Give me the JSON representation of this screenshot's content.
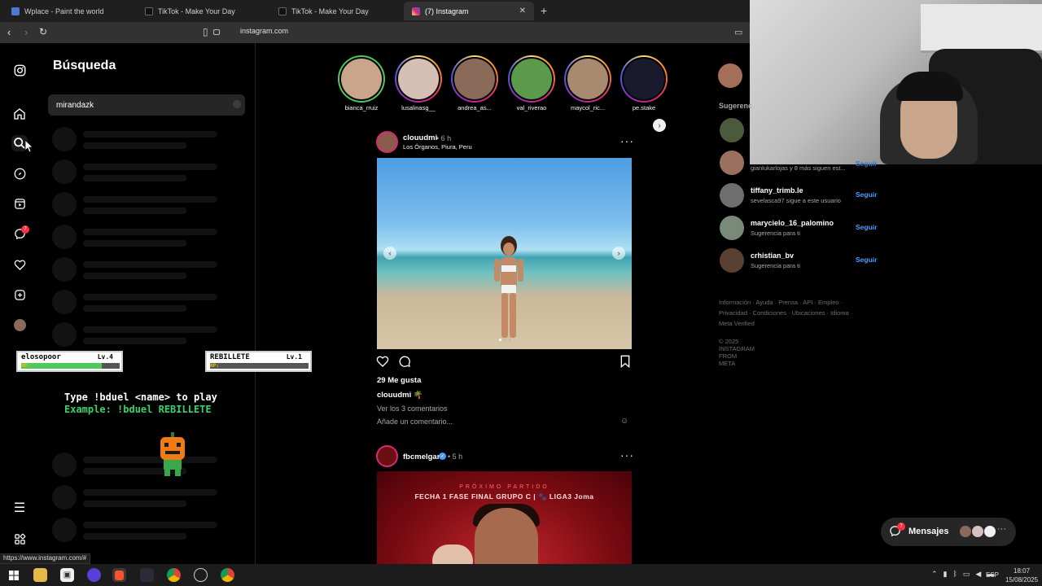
{
  "browser": {
    "tabs": [
      {
        "label": "Wplace - Paint the world",
        "color": "#4a7bd0"
      },
      {
        "label": "TikTok - Make Your Day",
        "color": "#111111"
      },
      {
        "label": "TikTok - Make Your Day",
        "color": "#111111"
      },
      {
        "label": "(7) Instagram",
        "color": "#d62976"
      }
    ],
    "url": "instagram.com",
    "status_url": "https://www.instagram.com/#"
  },
  "search": {
    "title": "Búsqueda",
    "query": "mirandazk"
  },
  "nav": {
    "notifications_badge": "7"
  },
  "overlay": {
    "player1": {
      "name": "elosopoor",
      "level": "Lv.4",
      "hp_label": "HP:",
      "hp_fraction": 0.82
    },
    "player2": {
      "name": "REBILLETE",
      "level": "Lv.1",
      "hp_label": "HP:",
      "hp_fraction": 0.0
    },
    "line1": "Type !bduel <name> to play",
    "line2": "Example: !bduel REBILLETE"
  },
  "stories": [
    {
      "name": "bianca_rruiz",
      "seen": true
    },
    {
      "name": "lusalinasg__",
      "seen": false
    },
    {
      "name": "andrea_as...",
      "seen": false
    },
    {
      "name": "val_riverao",
      "seen": false
    },
    {
      "name": "maycol_ric...",
      "seen": false
    },
    {
      "name": "pe.stake",
      "seen": false
    }
  ],
  "post1": {
    "user": "clouudmi",
    "time": "• 6 h",
    "location": "Los Órganos, Piura, Peru",
    "likes": "29 Me gusta",
    "caption": "clouudmi 🌴",
    "comments": "Ver los 3 comentarios",
    "add_comment": "Añade un comentario..."
  },
  "post2": {
    "user": "fbcmelgar",
    "time": "• 5 h",
    "line1": "PRÓXIMO PARTIDO",
    "line2": "FECHA 1 FASE FINAL GRUPO C | 🐾 LIGA3 Joma"
  },
  "suggestions": {
    "label": "Sugerenc",
    "items": [
      {
        "user": "",
        "sub": ""
      },
      {
        "user": "",
        "sub": "gianlukarlojas y 8 más siguen est..."
      },
      {
        "user": "tiffany_trimb.le",
        "sub": "sevelasca97 sigue a este usuario",
        "follow": "Seguir"
      },
      {
        "user": "marycielo_16_palomino",
        "sub": "Sugerencia para ti",
        "follow": "Seguir"
      },
      {
        "user": "crhistian_bv",
        "sub": "Sugerencia para ti",
        "follow": "Seguir"
      }
    ],
    "hidden_follow": "Seguir",
    "footer": "Información · Ayuda · Prensa · API · Empleo · Privacidad · Condiciones · Ubicaciones · Idioma · Meta Verified",
    "copyright": "© 2025 INSTAGRAM FROM META"
  },
  "messages": {
    "label": "Mensajes",
    "badge": "7"
  },
  "taskbar": {
    "lang": "ESP",
    "time": "18:07",
    "date": "15/08/2025"
  }
}
